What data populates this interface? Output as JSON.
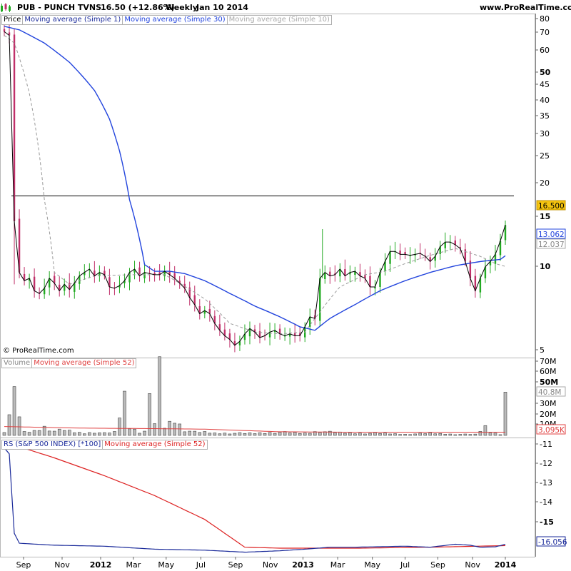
{
  "header": {
    "symbol": "PUB - PUNCH TVNS",
    "price": "16.50 (+12.86%)",
    "period": "Weekly",
    "date": "Jan 10 2014",
    "site": "www.ProRealTime.com"
  },
  "copyright": "© ProRealTime.com",
  "colors": {
    "up": "#22aa22",
    "down": "#c0306a",
    "close": "#000000",
    "ma30": "#2244dd",
    "ma10": "#999999",
    "volume_ma": "#e04040",
    "rs": "#1a2a9a",
    "rs_ma": "#dd2222",
    "price_tag": "#f5c40f",
    "hline": "#000000"
  },
  "price_panel": {
    "legend": [
      "Price",
      "Moving average (Simple 1)",
      "Moving average (Simple 30)",
      "Moving average (Simple 10)"
    ],
    "axis_ticks": [
      "80",
      "70",
      "60",
      "50",
      "45",
      "40",
      "35",
      "30",
      "25",
      "20",
      "15",
      "10",
      "5"
    ],
    "bold_ticks": [
      "50",
      "15",
      "10"
    ],
    "hline_value": 18,
    "tags": {
      "last": "16.500",
      "ma30": "13.062",
      "ma10": "12.037"
    }
  },
  "volume_panel": {
    "legend": [
      "Volume",
      "Moving average (Simple 52)"
    ],
    "axis_ticks": [
      "70M",
      "60M",
      "50M",
      "30M",
      "20M",
      "10M"
    ],
    "bold_ticks": [
      "50M"
    ],
    "tags": {
      "ma": "40.8M",
      "last": "3,095K"
    }
  },
  "rs_panel": {
    "legend": [
      "RS (S&P 500 INDEX) [*100]",
      "Moving average (Simple 52)"
    ],
    "axis_ticks": [
      "-11",
      "-12",
      "-13",
      "-14",
      "-15"
    ],
    "bold_ticks": [
      "-15"
    ],
    "tag": "-16.056"
  },
  "x_labels": [
    "Sep",
    "Nov",
    "2012",
    "Mar",
    "May",
    "Jul",
    "Sep",
    "Nov",
    "2013",
    "Mar",
    "May",
    "Jul",
    "Sep",
    "Nov",
    "2014"
  ],
  "x_bold": [
    "2012",
    "2013",
    "2014"
  ],
  "chart_data": {
    "type": "candlestick",
    "log_scale": true,
    "close_anchors": [
      [
        0,
        72
      ],
      [
        1,
        70
      ],
      [
        2,
        17
      ],
      [
        3,
        11.5
      ],
      [
        4,
        10.8
      ],
      [
        5,
        11
      ],
      [
        6,
        10
      ],
      [
        7,
        9.8
      ],
      [
        8,
        10.2
      ],
      [
        9,
        11
      ],
      [
        10,
        10.6
      ],
      [
        11,
        10
      ],
      [
        12,
        10.5
      ],
      [
        13,
        10.1
      ],
      [
        14,
        10.6
      ],
      [
        15,
        11.2
      ],
      [
        16,
        11.5
      ],
      [
        17,
        11.8
      ],
      [
        18,
        11.2
      ],
      [
        19,
        11.5
      ],
      [
        20,
        11.3
      ],
      [
        21,
        10.3
      ],
      [
        22,
        10.2
      ],
      [
        23,
        10.4
      ],
      [
        24,
        10.8
      ],
      [
        25,
        11.5
      ],
      [
        26,
        11.8
      ],
      [
        27,
        11.2
      ],
      [
        28,
        11.5
      ],
      [
        29,
        11.4
      ],
      [
        30,
        11.3
      ],
      [
        31,
        11.3
      ],
      [
        32,
        11.6
      ],
      [
        33,
        11.3
      ],
      [
        34,
        11
      ],
      [
        35,
        10.6
      ],
      [
        36,
        10.2
      ],
      [
        37,
        9.5
      ],
      [
        38,
        9
      ],
      [
        39,
        8.4
      ],
      [
        40,
        8.6
      ],
      [
        41,
        8.4
      ],
      [
        42,
        7.8
      ],
      [
        43,
        7.4
      ],
      [
        44,
        7.1
      ],
      [
        45,
        6.9
      ],
      [
        46,
        6.6
      ],
      [
        47,
        6.8
      ],
      [
        48,
        7.2
      ],
      [
        49,
        7.5
      ],
      [
        50,
        7.3
      ],
      [
        51,
        7.0
      ],
      [
        52,
        7.1
      ],
      [
        53,
        7.3
      ],
      [
        54,
        7.4
      ],
      [
        55,
        7.2
      ],
      [
        56,
        7.1
      ],
      [
        57,
        7.2
      ],
      [
        58,
        7.1
      ],
      [
        59,
        7.1
      ],
      [
        60,
        7.6
      ],
      [
        61,
        8.2
      ],
      [
        62,
        8.1
      ],
      [
        63,
        11
      ],
      [
        64,
        11.5
      ],
      [
        65,
        11.2
      ],
      [
        66,
        11.3
      ],
      [
        67,
        11.8
      ],
      [
        68,
        11.2
      ],
      [
        69,
        11.5
      ],
      [
        70,
        11.6
      ],
      [
        71,
        11.2
      ],
      [
        72,
        11
      ],
      [
        73,
        10.3
      ],
      [
        74,
        10.3
      ],
      [
        75,
        11.5
      ],
      [
        76,
        12.5
      ],
      [
        77,
        13.5
      ],
      [
        78,
        13.5
      ],
      [
        79,
        13.2
      ],
      [
        80,
        13.2
      ],
      [
        81,
        13.1
      ],
      [
        82,
        13.2
      ],
      [
        83,
        13.3
      ],
      [
        84,
        13
      ],
      [
        85,
        12.5
      ],
      [
        86,
        13
      ],
      [
        87,
        14
      ],
      [
        88,
        14.5
      ],
      [
        89,
        14.5
      ],
      [
        90,
        14.2
      ],
      [
        91,
        13.8
      ],
      [
        92,
        12.5
      ],
      [
        93,
        11
      ],
      [
        94,
        10
      ],
      [
        95,
        11
      ],
      [
        96,
        12
      ],
      [
        97,
        12.5
      ],
      [
        98,
        13.2
      ],
      [
        99,
        14.62
      ],
      [
        100,
        16.5
      ]
    ],
    "ma30_anchors": [
      [
        0,
        75
      ],
      [
        3,
        73
      ],
      [
        8,
        66
      ],
      [
        13,
        57
      ],
      [
        18,
        46
      ],
      [
        21,
        37
      ],
      [
        23,
        29
      ],
      [
        25,
        20
      ],
      [
        28,
        12.2
      ],
      [
        30,
        11.6
      ],
      [
        33,
        11.6
      ],
      [
        36,
        11.4
      ],
      [
        40,
        10.8
      ],
      [
        45,
        9.8
      ],
      [
        50,
        8.9
      ],
      [
        55,
        8.2
      ],
      [
        59,
        7.6
      ],
      [
        62,
        7.4
      ],
      [
        65,
        8.1
      ],
      [
        70,
        9.0
      ],
      [
        75,
        10.0
      ],
      [
        80,
        10.8
      ],
      [
        85,
        11.5
      ],
      [
        90,
        12.1
      ],
      [
        95,
        12.5
      ],
      [
        99,
        12.7
      ],
      [
        100,
        13.062
      ]
    ],
    "ma10_anchors": [
      [
        0,
        70
      ],
      [
        2,
        66
      ],
      [
        5,
        45
      ],
      [
        8,
        20
      ],
      [
        10,
        11.5
      ],
      [
        13,
        10.5
      ],
      [
        18,
        11.2
      ],
      [
        25,
        11.3
      ],
      [
        32,
        11.3
      ],
      [
        35,
        10.6
      ],
      [
        40,
        9.4
      ],
      [
        45,
        7.8
      ],
      [
        50,
        7.3
      ],
      [
        55,
        7.2
      ],
      [
        60,
        7.3
      ],
      [
        63,
        8.5
      ],
      [
        67,
        10.3
      ],
      [
        72,
        11.3
      ],
      [
        76,
        11.6
      ],
      [
        80,
        12.3
      ],
      [
        85,
        13.1
      ],
      [
        90,
        13.8
      ],
      [
        95,
        13
      ],
      [
        98,
        12.3
      ],
      [
        100,
        12.037
      ]
    ],
    "volume_anchors": [
      [
        0,
        4
      ],
      [
        2,
        35
      ],
      [
        4,
        3
      ],
      [
        6,
        4
      ],
      [
        8,
        8
      ],
      [
        10,
        4
      ],
      [
        12,
        5
      ],
      [
        14,
        3
      ],
      [
        16,
        2
      ],
      [
        18,
        3
      ],
      [
        20,
        2
      ],
      [
        22,
        3
      ],
      [
        24,
        36
      ],
      [
        25,
        8
      ],
      [
        27,
        3
      ],
      [
        28,
        4
      ],
      [
        29,
        30
      ],
      [
        30,
        12
      ],
      [
        31,
        60
      ],
      [
        32,
        8
      ],
      [
        34,
        15
      ],
      [
        36,
        5
      ],
      [
        38,
        3
      ],
      [
        40,
        3
      ],
      [
        42,
        2
      ],
      [
        45,
        2
      ],
      [
        50,
        2
      ],
      [
        55,
        3
      ],
      [
        60,
        2
      ],
      [
        63,
        4
      ],
      [
        65,
        3
      ],
      [
        70,
        2
      ],
      [
        75,
        2
      ],
      [
        80,
        1
      ],
      [
        85,
        2
      ],
      [
        90,
        1
      ],
      [
        94,
        1
      ],
      [
        96,
        8
      ],
      [
        97,
        3
      ],
      [
        99,
        1
      ],
      [
        100,
        40.8
      ]
    ],
    "volume_ma_anchors": [
      [
        0,
        8.5
      ],
      [
        15,
        7
      ],
      [
        30,
        6.5
      ],
      [
        40,
        6
      ],
      [
        55,
        3.5
      ],
      [
        70,
        3
      ],
      [
        85,
        3
      ],
      [
        100,
        3.1
      ]
    ],
    "rs_anchors": [
      [
        0,
        -11.2
      ],
      [
        1,
        -11.5
      ],
      [
        2,
        -15.5
      ],
      [
        3,
        -16.0
      ],
      [
        10,
        -16.1
      ],
      [
        20,
        -16.15
      ],
      [
        30,
        -16.3
      ],
      [
        40,
        -16.35
      ],
      [
        48,
        -16.45
      ],
      [
        55,
        -16.38
      ],
      [
        60,
        -16.3
      ],
      [
        65,
        -16.2
      ],
      [
        70,
        -16.2
      ],
      [
        80,
        -16.15
      ],
      [
        85,
        -16.2
      ],
      [
        90,
        -16.05
      ],
      [
        93,
        -16.1
      ],
      [
        95,
        -16.2
      ],
      [
        98,
        -16.18
      ],
      [
        100,
        -16.056
      ]
    ],
    "rs_ma_anchors": [
      [
        0,
        -10.9
      ],
      [
        10,
        -11.7
      ],
      [
        20,
        -12.6
      ],
      [
        30,
        -13.6
      ],
      [
        40,
        -14.8
      ],
      [
        48,
        -16.2
      ],
      [
        55,
        -16.25
      ],
      [
        70,
        -16.25
      ],
      [
        85,
        -16.2
      ],
      [
        100,
        -16.12
      ]
    ]
  }
}
